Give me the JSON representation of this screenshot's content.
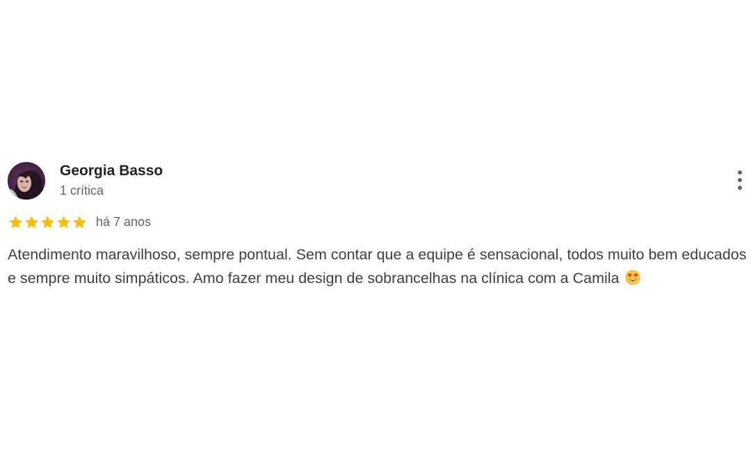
{
  "review": {
    "author_name": "Georgia Basso",
    "author_meta": "1 crítica",
    "rating": 5,
    "rating_max": 5,
    "time_ago": "há 7 anos",
    "text": "Atendimento maravilhoso, sempre pontual. Sem contar que a equipe é sensacional, todos muito bem educados e sempre muito simpáticos. Amo fazer meu design de sobrancelhas na clínica com a Camila",
    "emoji": "smiling-face-with-heart-eyes"
  },
  "colors": {
    "star": "#FBBC04",
    "name": "#202124",
    "secondary": "#5f6368",
    "body": "#3c4043"
  },
  "icons": {
    "menu": "more-vert-icon",
    "star": "star-icon"
  }
}
